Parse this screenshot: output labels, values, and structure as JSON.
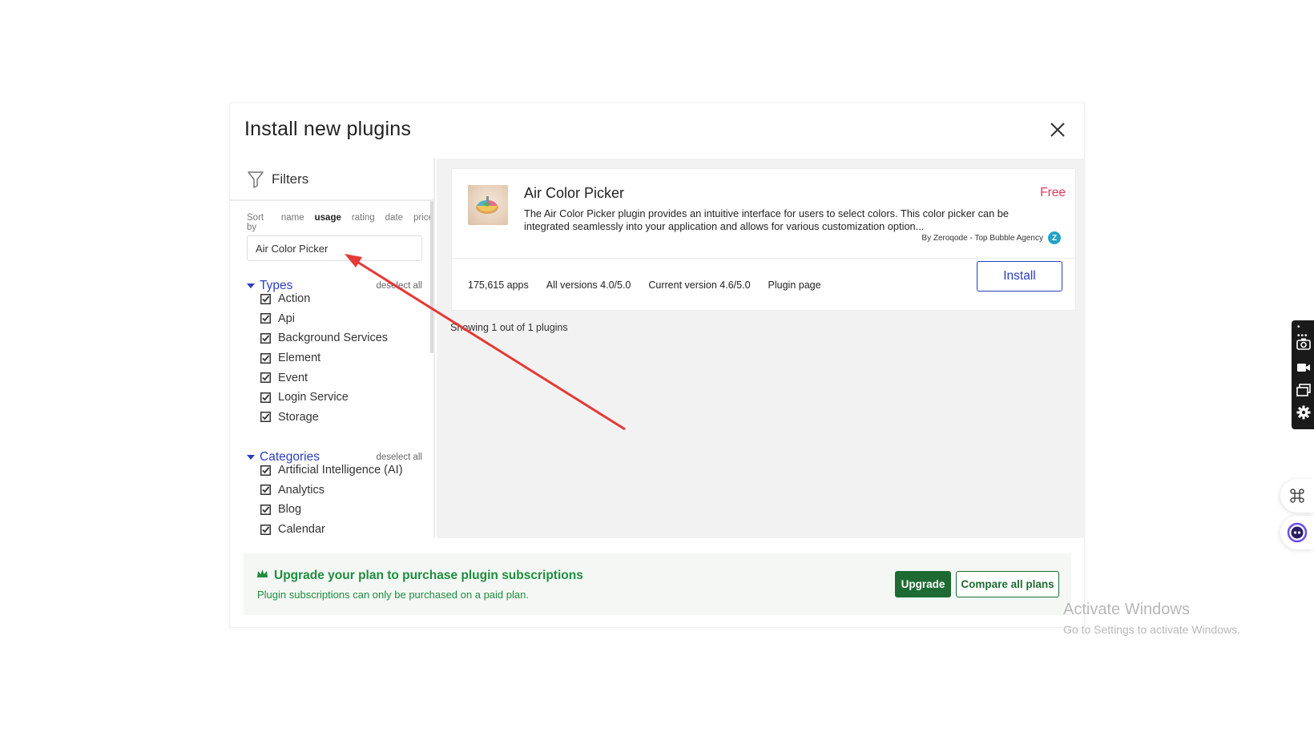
{
  "modal": {
    "title": "Install new plugins"
  },
  "filters": {
    "label": "Filters",
    "sort_by": "Sort by",
    "sort_options": [
      {
        "label": "name",
        "active": false
      },
      {
        "label": "usage",
        "active": true
      },
      {
        "label": "rating",
        "active": false
      },
      {
        "label": "date",
        "active": false
      },
      {
        "label": "price",
        "active": false
      }
    ],
    "search_value": "Air Color Picker",
    "types": {
      "title": "Types",
      "deselect": "deselect all",
      "items": [
        "Action",
        "Api",
        "Background Services",
        "Element",
        "Event",
        "Login Service",
        "Storage"
      ]
    },
    "categories": {
      "title": "Categories",
      "deselect": "deselect all",
      "items": [
        "Artificial Intelligence (AI)",
        "Analytics",
        "Blog",
        "Calendar"
      ]
    }
  },
  "plugin": {
    "name": "Air Color Picker",
    "price": "Free",
    "description": "The Air Color Picker plugin provides an intuitive interface for users to select colors. This color picker can be integrated seamlessly into your application and allows for various customization option...",
    "author": "By Zeroqode - Top Bubble Agency",
    "badge": "Z",
    "apps": "175,615 apps",
    "all_versions": "All versions 4.0/5.0",
    "current_version": "Current version 4.6/5.0",
    "plugin_page": "Plugin page",
    "install_label": "Install"
  },
  "results": {
    "showing": "Showing 1 out of 1 plugins"
  },
  "footer": {
    "heading": "Upgrade your plan to purchase plugin subscriptions",
    "subtext": "Plugin subscriptions can only be purchased on a paid plan.",
    "upgrade_label": "Upgrade",
    "compare_label": "Compare all plans"
  },
  "recorder": {
    "dots": "• •••"
  },
  "watermark": {
    "line1": "Activate Windows",
    "line2": "Go to Settings to activate Windows."
  },
  "colors": {
    "accent_blue": "#2b3fbf",
    "price_pink": "#e8335d",
    "upgrade_green": "#1d6b33",
    "annotation_red": "#e53935"
  }
}
